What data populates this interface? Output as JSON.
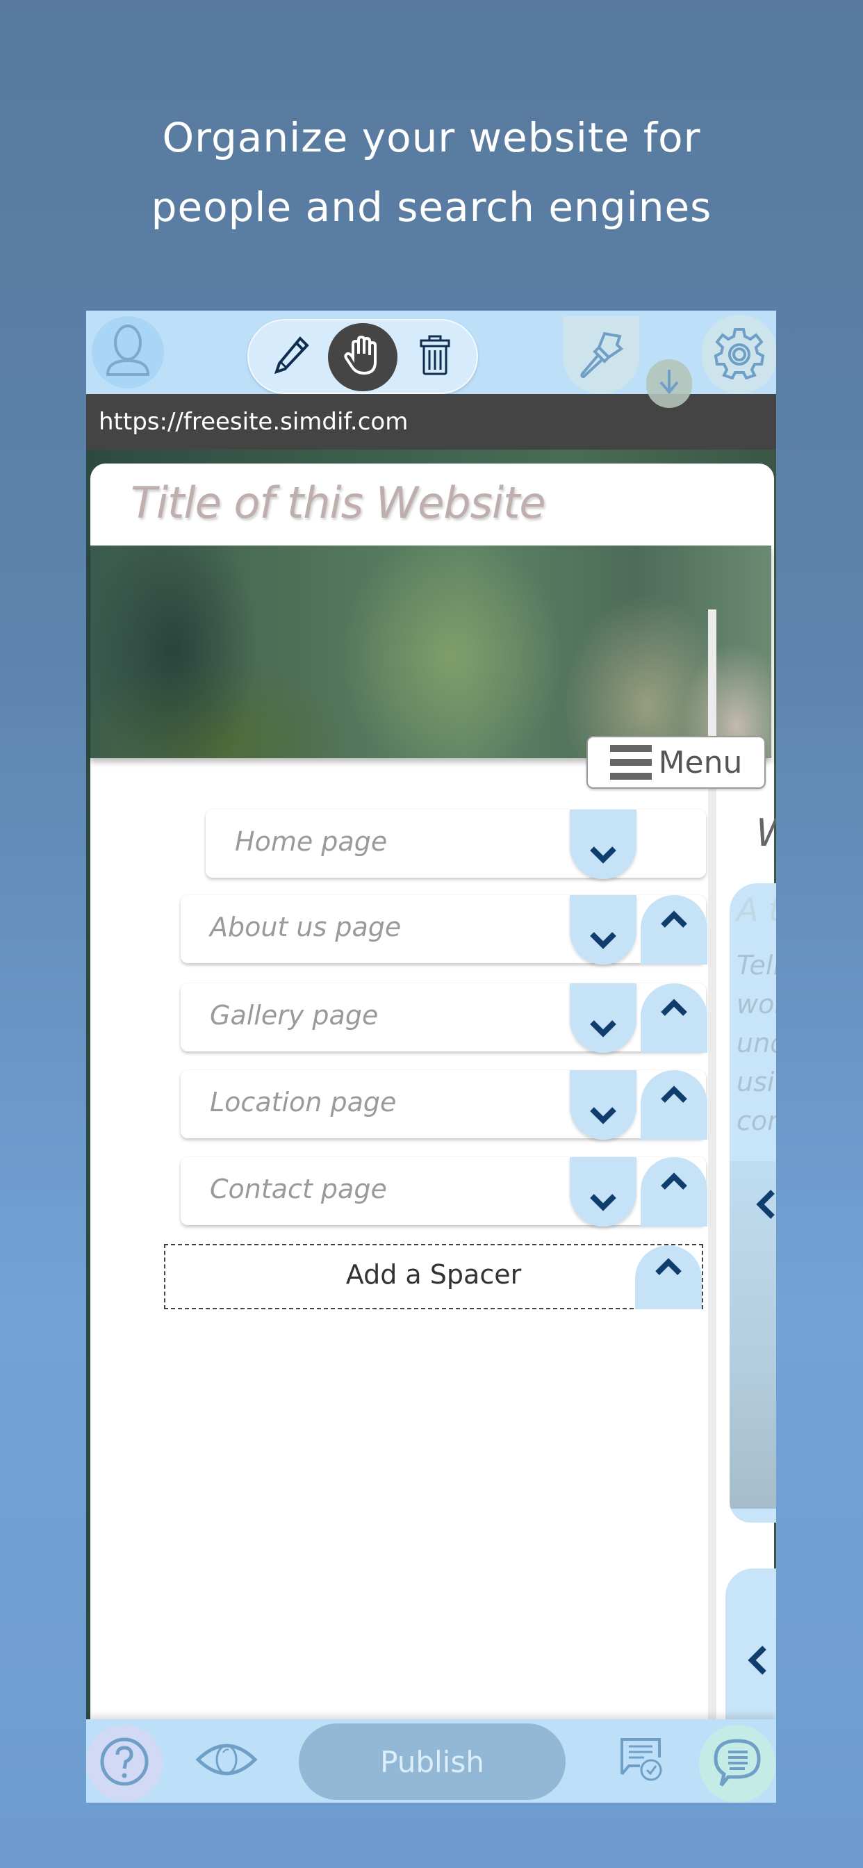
{
  "headline": {
    "line1": "Organize your website for",
    "line2": "people and search engines"
  },
  "toolbar": {
    "icons": {
      "account": "user-silhouette-icon",
      "edit": "pencil-icon",
      "move": "hand-icon",
      "delete": "trash-icon",
      "design": "paintbrush-icon",
      "publish_status": "down-arrow-icon",
      "settings": "gear-icon"
    },
    "active_tool": "move"
  },
  "url_bar": {
    "url": "https://freesite.simdif.com"
  },
  "site": {
    "title": "Title of this Website",
    "menu_label": "Menu"
  },
  "pages": [
    {
      "label": "Home page",
      "can_move_up": false,
      "can_move_down": true
    },
    {
      "label": "About us page",
      "can_move_up": true,
      "can_move_down": true
    },
    {
      "label": "Gallery page",
      "can_move_up": true,
      "can_move_down": true
    },
    {
      "label": "Location page",
      "can_move_up": true,
      "can_move_down": true
    },
    {
      "label": "Contact page",
      "can_move_up": true,
      "can_move_down": true
    }
  ],
  "spacer": {
    "label": "Add a Spacer"
  },
  "right_preview": {
    "heading_partial": "W",
    "block_title_partial": "A t",
    "block_text_partial": [
      "Tell",
      "wor",
      "und",
      "usi",
      "con"
    ]
  },
  "bottom_bar": {
    "publish_label": "Publish",
    "icons": {
      "help": "question-mark-icon",
      "preview": "eye-icon",
      "review": "document-check-icon",
      "chat": "speech-bubble-icon"
    }
  },
  "colors": {
    "toolbar_bg": "#bde0f8",
    "button_blue": "#c6e2f7",
    "arrow_navy": "#0f3d6e",
    "url_bar_bg": "#444444",
    "publish_bg": "#92b8d6"
  }
}
